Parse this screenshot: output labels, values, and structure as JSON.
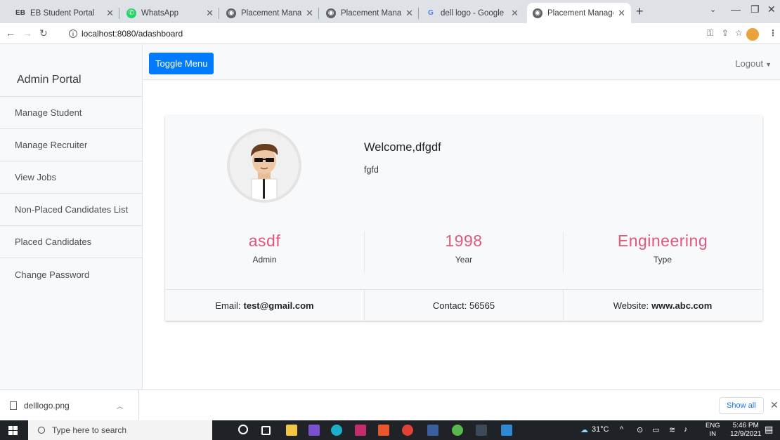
{
  "browser": {
    "tabs": [
      {
        "title": "EB Student Portal",
        "icon": "eb-portal-icon"
      },
      {
        "title": "WhatsApp",
        "icon": "whatsapp-icon"
      },
      {
        "title": "Placement Manageme",
        "icon": "globe-icon"
      },
      {
        "title": "Placement Manageme",
        "icon": "globe-icon"
      },
      {
        "title": "dell logo - Google Sea",
        "icon": "google-icon"
      },
      {
        "title": "Placement Manageme",
        "icon": "globe-icon",
        "active": true
      }
    ],
    "url": "localhost:8080/adashboard"
  },
  "sidebar": {
    "heading": "Admin Portal",
    "items": [
      {
        "label": "Manage Student"
      },
      {
        "label": "Manage Recruiter"
      },
      {
        "label": "View Jobs"
      },
      {
        "label": "Non-Placed Candidates List"
      },
      {
        "label": "Placed Candidates"
      },
      {
        "label": "Change Password"
      }
    ]
  },
  "topnav": {
    "toggle_label": "Toggle Menu",
    "logout_label": "Logout"
  },
  "profile": {
    "welcome": "Welcome,dfgdf",
    "subname": "fgfd",
    "stats": [
      {
        "value": "asdf",
        "label": "Admin"
      },
      {
        "value": "1998",
        "label": "Year"
      },
      {
        "value": "Engineering",
        "label": "Type"
      }
    ],
    "email_label": "Email:",
    "email": "test@gmail.com",
    "contact_label": "Contact:",
    "contact": "56565",
    "website_label": "Website:",
    "website": "www.abc.com"
  },
  "downloads": {
    "file": "delllogo.png",
    "show_all": "Show all"
  },
  "taskbar": {
    "search_placeholder": "Type here to search",
    "weather": "31°C",
    "lang_line1": "ENG",
    "lang_line2": "IN",
    "time": "5:46 PM",
    "date": "12/9/2021"
  },
  "colors": {
    "primary": "#007bff",
    "stat_accent": "#e0577c",
    "sidebar_bg": "#f8f9fa"
  }
}
